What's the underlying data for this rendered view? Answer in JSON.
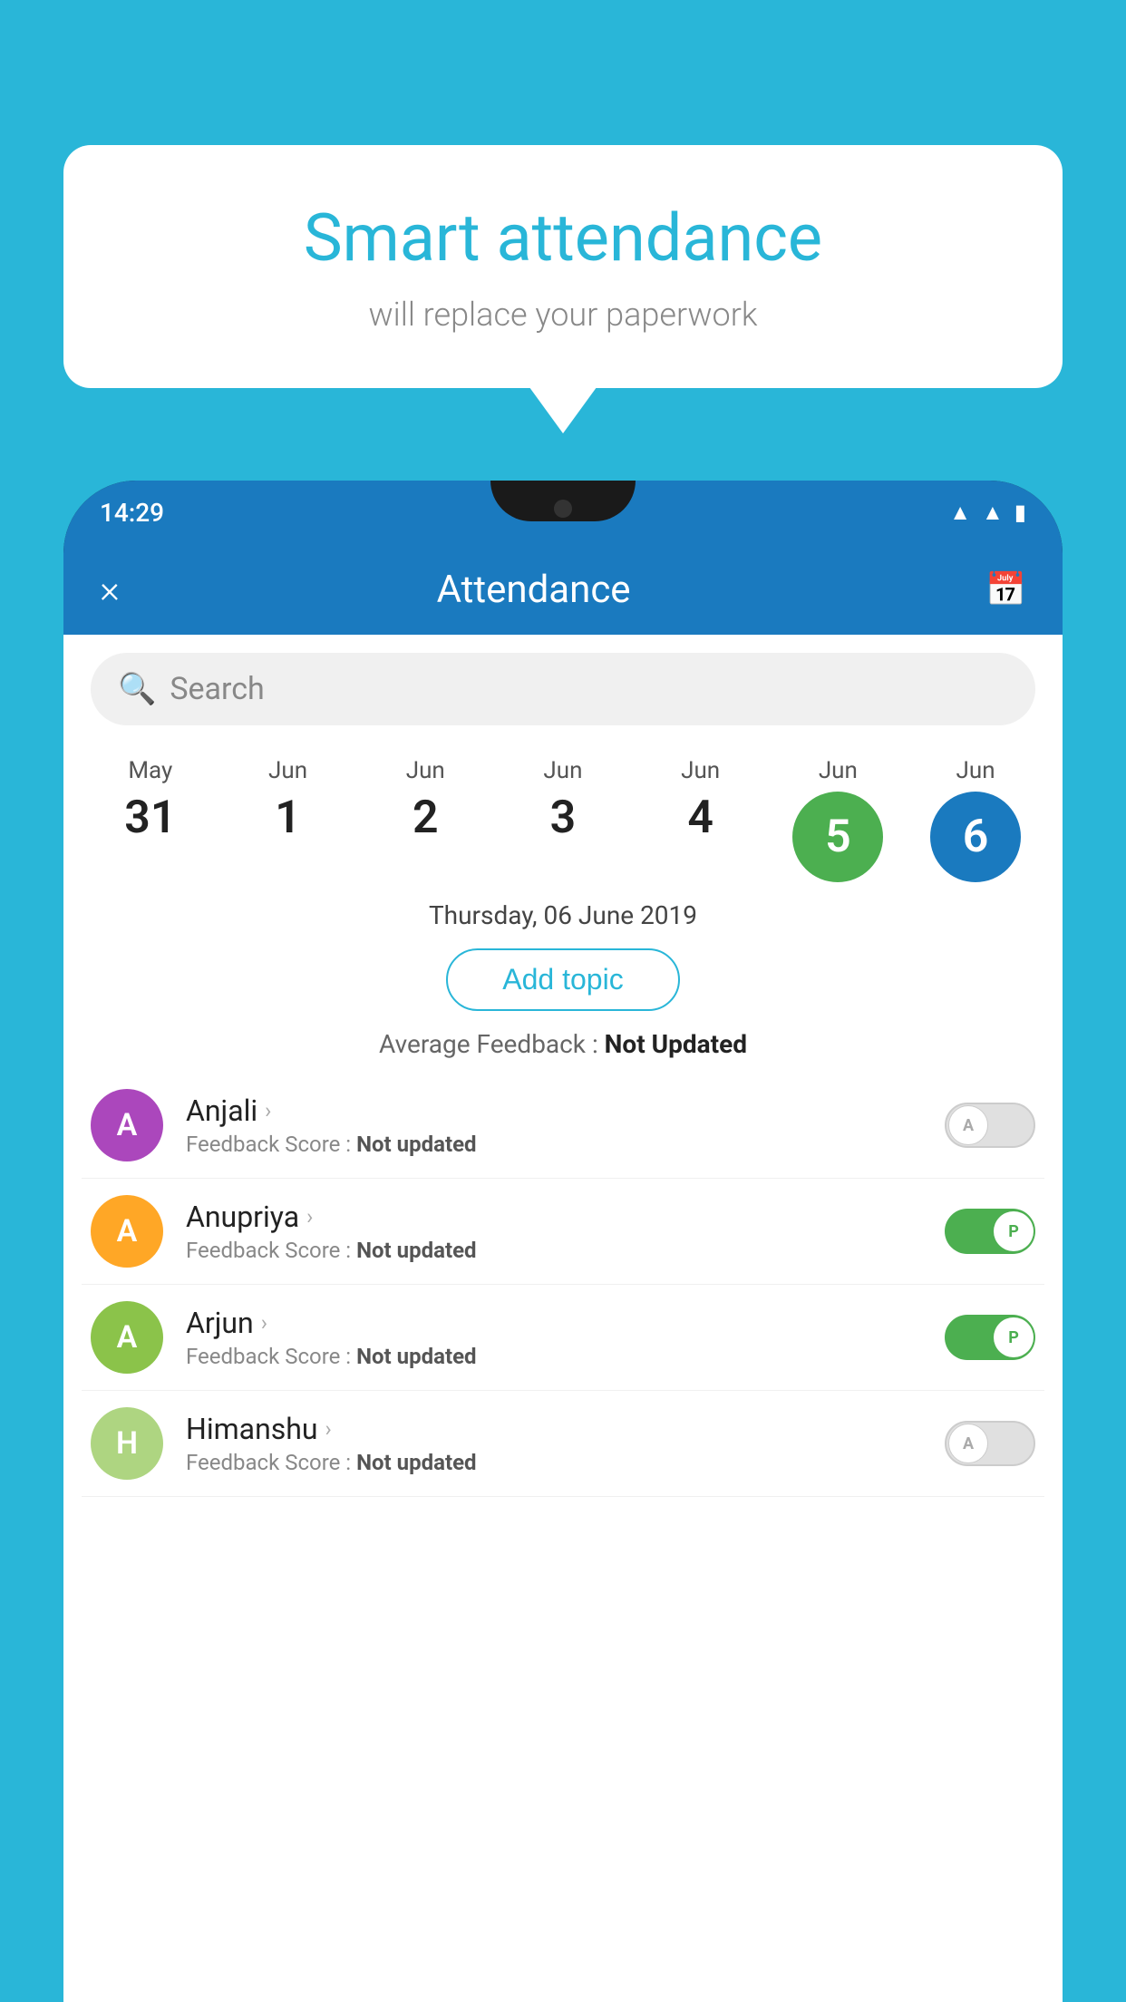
{
  "background": {
    "color": "#29b6d8"
  },
  "speech_bubble": {
    "title": "Smart attendance",
    "subtitle": "will replace your paperwork"
  },
  "status_bar": {
    "time": "14:29",
    "icons": [
      "wifi",
      "signal",
      "battery"
    ]
  },
  "app_header": {
    "close_label": "×",
    "title": "Attendance",
    "calendar_icon": "📅"
  },
  "search": {
    "placeholder": "Search"
  },
  "dates": [
    {
      "month": "May",
      "day": "31",
      "selected": ""
    },
    {
      "month": "Jun",
      "day": "1",
      "selected": ""
    },
    {
      "month": "Jun",
      "day": "2",
      "selected": ""
    },
    {
      "month": "Jun",
      "day": "3",
      "selected": ""
    },
    {
      "month": "Jun",
      "day": "4",
      "selected": ""
    },
    {
      "month": "Jun",
      "day": "5",
      "selected": "green"
    },
    {
      "month": "Jun",
      "day": "6",
      "selected": "blue"
    }
  ],
  "selected_date_label": "Thursday, 06 June 2019",
  "add_topic_label": "Add topic",
  "avg_feedback_label": "Average Feedback : ",
  "avg_feedback_value": "Not Updated",
  "students": [
    {
      "name": "Anjali",
      "avatar_letter": "A",
      "avatar_color": "#ab47bc",
      "feedback_label": "Feedback Score : ",
      "feedback_value": "Not updated",
      "status": "absent"
    },
    {
      "name": "Anupriya",
      "avatar_letter": "A",
      "avatar_color": "#ffa726",
      "feedback_label": "Feedback Score : ",
      "feedback_value": "Not updated",
      "status": "present"
    },
    {
      "name": "Arjun",
      "avatar_letter": "A",
      "avatar_color": "#8bc34a",
      "feedback_label": "Feedback Score : ",
      "feedback_value": "Not updated",
      "status": "present"
    },
    {
      "name": "Himanshu",
      "avatar_letter": "H",
      "avatar_color": "#aed581",
      "feedback_label": "Feedback Score : ",
      "feedback_value": "Not updated",
      "status": "absent"
    }
  ],
  "toggle_absent_label": "A",
  "toggle_present_label": "P"
}
